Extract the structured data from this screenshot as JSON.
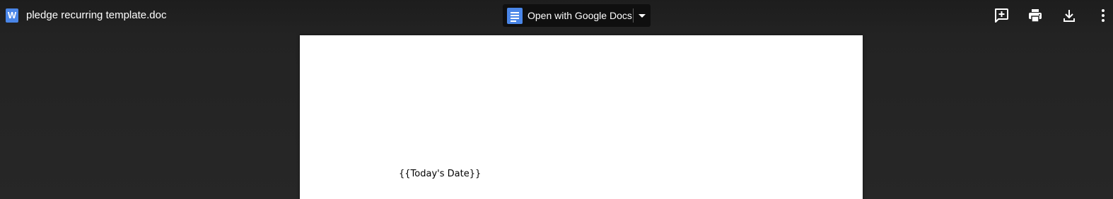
{
  "header": {
    "file_icon_letter": "W",
    "file_name": "pledge recurring template.doc",
    "open_with_label": "Open with Google Docs"
  },
  "toolbar": {
    "icons": [
      "add-comment-icon",
      "print-icon",
      "download-icon",
      "more-vert-icon"
    ]
  },
  "document": {
    "date_placeholder": "{{Today's Date}}"
  },
  "colors": {
    "word_icon": "#4a86e8",
    "docs_icon": "#4a86e8",
    "viewer_background": "#232323",
    "page": "#ffffff"
  }
}
